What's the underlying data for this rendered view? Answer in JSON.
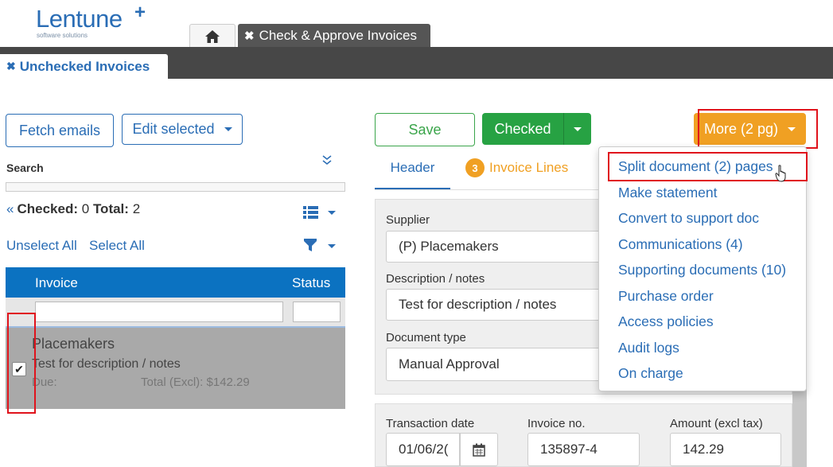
{
  "logo": {
    "brand": "Lentune",
    "plus": "+",
    "tagline": "software solutions"
  },
  "tabs": {
    "home_icon": "home-icon",
    "active_close": "✖",
    "active_label": "Check & Approve Invoices"
  },
  "subtab": {
    "close": "✖",
    "label": "Unchecked Invoices"
  },
  "left": {
    "fetch_label": "Fetch emails",
    "edit_label": "Edit selected",
    "search_label": "Search",
    "collapse_icon": "⌄⌄",
    "checked_prefix": "«",
    "checked_label": "Checked:",
    "checked_value": "0",
    "total_label": "Total:",
    "total_value": "2",
    "unselect_all": "Unselect All",
    "select_all": "Select All",
    "columns": [
      "Invoice",
      "Status"
    ],
    "rows": [
      {
        "supplier": "Placemakers",
        "description": "Test for description / notes",
        "due_label": "Due:",
        "total": "Total (Excl): $142.29",
        "checked": "✔"
      }
    ]
  },
  "right": {
    "save_label": "Save",
    "checked_label": "Checked",
    "more_label": "More (2 pg)",
    "tab_header": "Header",
    "tab_lines_count": "3",
    "tab_lines_label": "Invoice Lines",
    "supplier_label": "Supplier",
    "supplier_value": "(P) Placemakers",
    "desc_label": "Description / notes",
    "desc_value": "Test for description / notes",
    "doctype_label": "Document type",
    "doctype_value": "Manual Approval",
    "tdate_label": "Transaction date",
    "tdate_value": "01/06/2(",
    "invno_label": "Invoice no.",
    "invno_value": "135897-4",
    "amount_label": "Amount (excl tax)",
    "amount_value": "142.29"
  },
  "more_menu": [
    "Split document (2) pages",
    "Make statement",
    "Convert to support doc",
    "Communications (4)",
    "Supporting documents (10)",
    "Purchase order",
    "Access policies",
    "Audit logs",
    "On charge"
  ],
  "colors": {
    "brand_blue": "#2a6db5",
    "grid_header": "#0b72c1",
    "green": "#27a243",
    "orange": "#f0a023",
    "highlight_red": "#e0131c"
  }
}
